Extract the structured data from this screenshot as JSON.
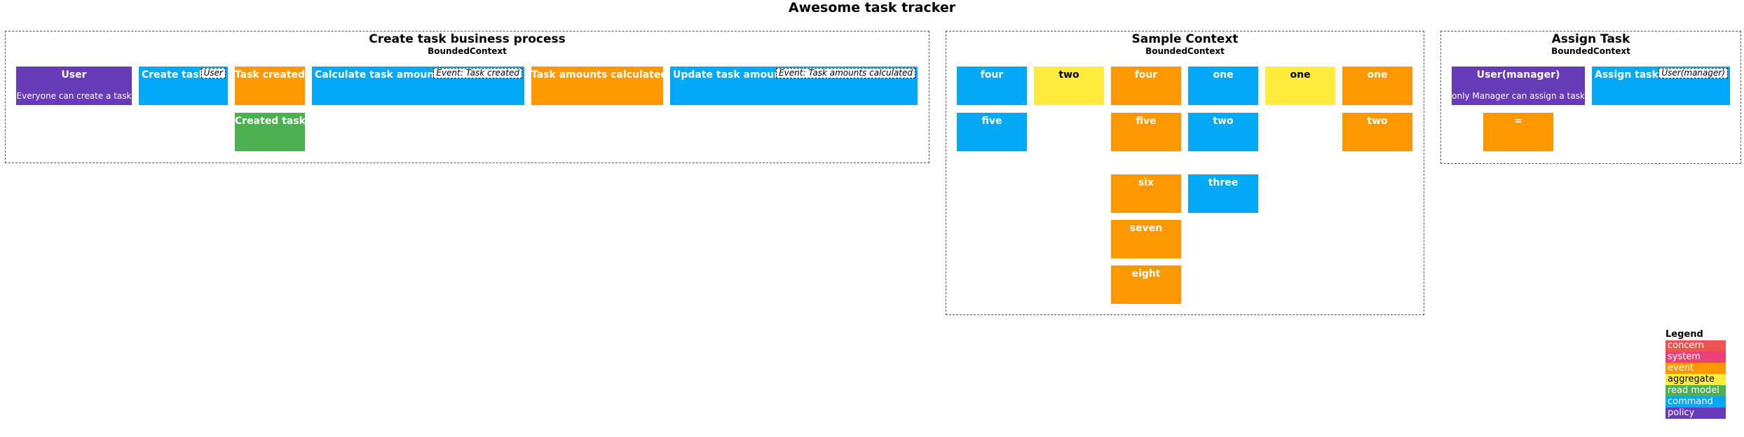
{
  "title": "Awesome task tracker",
  "colors": {
    "concern": "#ef5350",
    "system": "#ec407a",
    "event": "#ff9800",
    "aggregate": "#ffeb3b",
    "read_model": "#4caf50",
    "command": "#03a9f4",
    "policy": "#673ab7"
  },
  "contexts": {
    "create": {
      "name": "Create task business process",
      "type": "BoundedContext",
      "user": {
        "label": "User",
        "sub": "Everyone can create a task"
      },
      "create_task": {
        "label": "Create task",
        "tag": "User"
      },
      "task_created": {
        "label": "Task created"
      },
      "created_task": {
        "label": "Created task"
      },
      "calculate": {
        "label": "Calculate task amounts",
        "tag": "Event: Task created"
      },
      "amounts_calculated": {
        "label": "Task amounts calculated"
      },
      "update": {
        "label": "Update task amounts",
        "tag": "Event: Task amounts calculated"
      }
    },
    "sample": {
      "name": "Sample Context",
      "type": "BoundedContext",
      "col1": [
        "four",
        "five"
      ],
      "col2": [
        "two"
      ],
      "col3": [
        "four",
        "five",
        "six",
        "seven",
        "eight"
      ],
      "col4": [
        "one",
        "two",
        "three"
      ],
      "col5": [
        "one"
      ],
      "col6": [
        "one",
        "two"
      ]
    },
    "assign": {
      "name": "Assign Task",
      "type": "BoundedContext",
      "manager": {
        "label": "User(manager)",
        "sub": "only Manager can assign a task"
      },
      "eq": {
        "label": "="
      },
      "assign_tasks": {
        "label": "Assign tasks",
        "tag": "User(manager)"
      }
    }
  },
  "legend": {
    "title": "Legend",
    "items": [
      "concern",
      "system",
      "event",
      "aggregate",
      "read model",
      "command",
      "policy"
    ]
  }
}
